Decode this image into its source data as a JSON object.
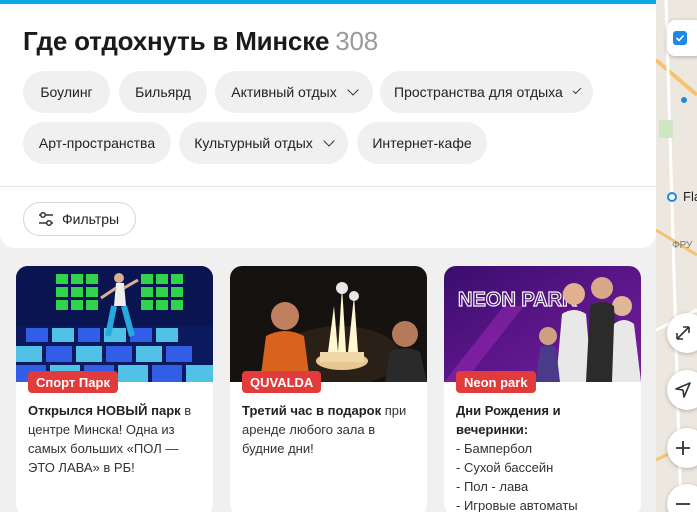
{
  "header": {
    "title": "Где отдохнуть в Минске",
    "count": "308"
  },
  "categories": [
    {
      "label": "Боулинг"
    },
    {
      "label": "Бильярд"
    },
    {
      "label": "Активный отдых"
    },
    {
      "label": "Пространства для отдыха"
    },
    {
      "label": "Арт-пространства"
    },
    {
      "label": "Культурный отдых"
    },
    {
      "label": "Интернет-кафе"
    }
  ],
  "filters": {
    "label": "Фильтры"
  },
  "cards": [
    {
      "badge": "Спорт Парк",
      "title": "Открылся НОВЫЙ парк",
      "text": " в центре Минска! Одна из самых больших «ПОЛ — ЭТО ЛАВА» в РБ!"
    },
    {
      "badge": "QUVALDA",
      "title": "Третий час в подарок",
      "text": " при аренде любого зала в будние дни!"
    },
    {
      "badge": "Neon park",
      "title": "Дни Рождения и вечеринки:",
      "items": [
        "- Бампербол",
        "- Сухой бассейн",
        "- Пол - лава",
        "- Игровые автоматы"
      ],
      "image_text": "NEON PARK"
    }
  ],
  "map": {
    "place_label": "Flash",
    "street_label": "ФРУ"
  },
  "colors": {
    "accent": "#0fa8e6",
    "badge": "#e23b3b"
  }
}
